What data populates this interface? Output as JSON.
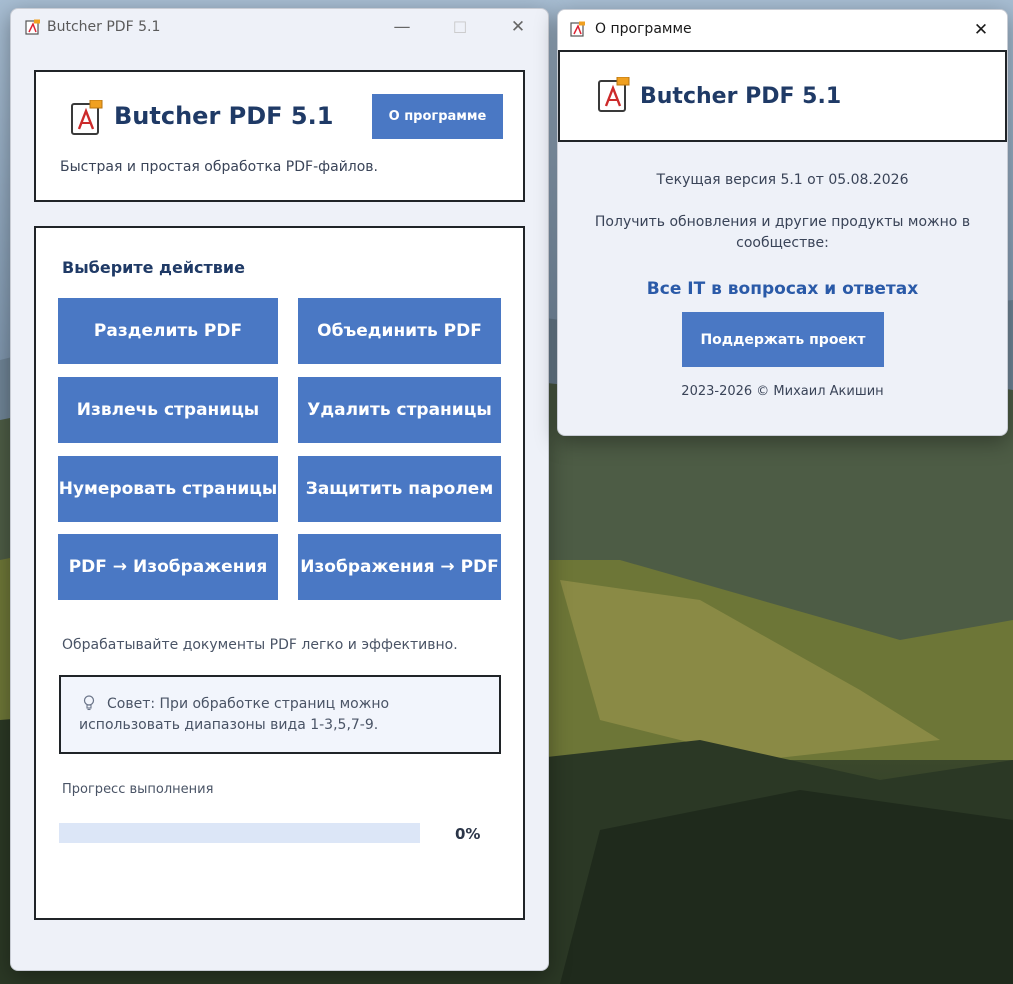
{
  "main_window": {
    "title": "Butcher PDF 5.1",
    "minimize_glyph": "—",
    "maximize_glyph": "☐",
    "close_glyph": "✕",
    "header": {
      "app_name": "Butcher PDF 5.1",
      "about_button": "О программе",
      "subtitle": "Быстрая и простая обработка PDF-файлов."
    },
    "actions": {
      "heading": "Выберите действие",
      "buttons": [
        "Разделить PDF",
        "Объединить PDF",
        "Извлечь страницы",
        "Удалить страницы",
        "Нумеровать страницы",
        "Защитить паролем",
        "PDF → Изображения",
        "Изображения → PDF"
      ],
      "tagline": "Обрабатывайте документы PDF легко и эффективно.",
      "tip_icon": "lightbulb-icon",
      "tip_line1": "Совет: При обработке страниц можно",
      "tip_line2": "использовать диапазоны вида 1-3,5,7-9.",
      "progress_label": "Прогресс выполнения",
      "progress_value": 0,
      "progress_text": "0%"
    }
  },
  "about_window": {
    "title": "О программе",
    "close_glyph": "✕",
    "app_name": "Butcher PDF 5.1",
    "version_text": "Текущая версия 5.1 от 05.08.2026",
    "updates_line1": "Получить обновления и другие продукты можно в",
    "updates_line2": "сообществе:",
    "community_link": "Все IT в вопросах и ответах",
    "support_button": "Поддержать проект",
    "copyright": "2023-2026 © Михаил Акишин"
  },
  "colors": {
    "accent": "#4a78c4",
    "window_bg": "#eef1f8",
    "title_blue": "#1f3a66",
    "progress_track": "#dce6f7"
  }
}
